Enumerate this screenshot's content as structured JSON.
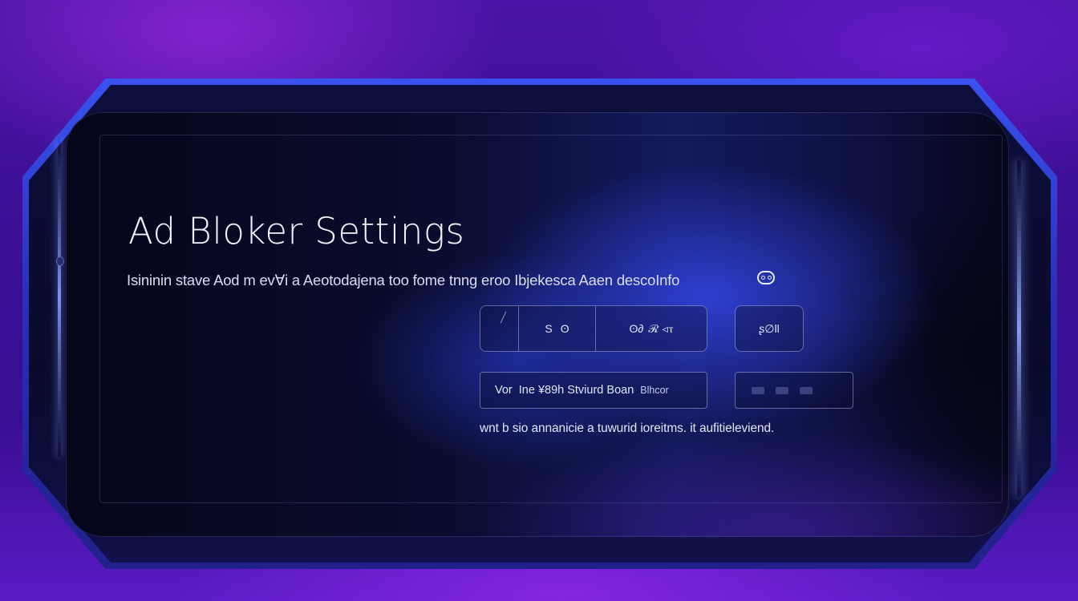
{
  "window": {
    "title": "Ad Bloker Settings",
    "description": "Isininin stave Aod m evⱯi a Aeotodajena too fome tnng eroo Ibjekesca Aaen descoInfo"
  },
  "icons": {
    "info": "info-icon",
    "toggle": "toggle-icon"
  },
  "controls": {
    "segmented": {
      "segment_a": "",
      "segment_b_label": "S",
      "segment_b_icon": "ʘ",
      "segment_c_prefix": "ʘ∂",
      "segment_c_label": "ℛ ⊲ⲧ"
    },
    "small_button_label": "ʂ∅ll",
    "select": {
      "value_prefix": "Vor",
      "value_main": "Ine ¥89h Stviurd Boan",
      "value_suffix": "Blhcor"
    },
    "footnote": "wnt b sio annanicie a tuwurid ioreitms. it aufitieleviend."
  },
  "colors": {
    "background": "#3a0f8c",
    "bezel": "#2a2fb8",
    "screen": "#0a0c2e",
    "accent_glow": "#3246e6",
    "text": "#f1f2ff"
  }
}
